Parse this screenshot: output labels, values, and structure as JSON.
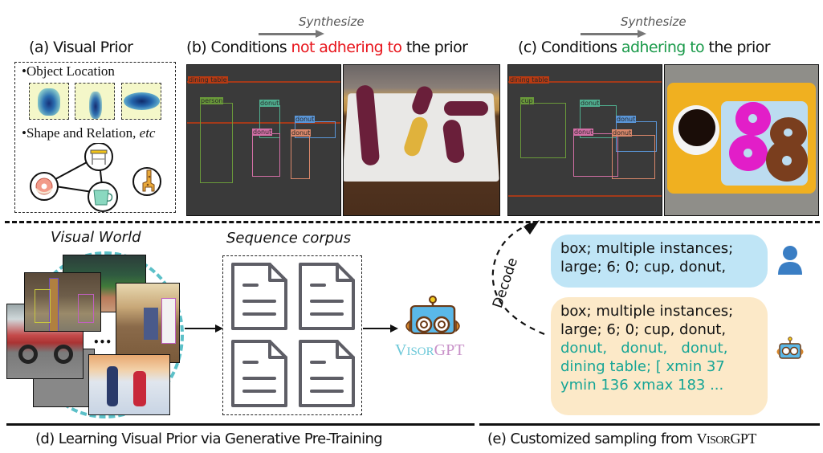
{
  "section_a": {
    "title": "(a) Visual Prior",
    "bullet_location": "•Object Location",
    "bullet_shape": "•Shape and Relation,",
    "bullet_shape_etc": "etc",
    "relation_icons": [
      "dining-table-icon",
      "donut-icon",
      "cup-icon",
      "giraffe-icon"
    ]
  },
  "section_b": {
    "synthesize": "Synthesize",
    "title_prefix": "(b) Conditions ",
    "title_highlight": "not adhering to",
    "title_suffix": " the prior",
    "highlight_color": "#e8141b",
    "boxes": [
      {
        "label": "dining table",
        "color": "#b83a12"
      },
      {
        "label": "person",
        "color": "#6a9a3a"
      },
      {
        "label": "donut",
        "color": "#4fae8f"
      },
      {
        "label": "donut",
        "color": "#5a96d8"
      },
      {
        "label": "donut",
        "color": "#d36fa6"
      },
      {
        "label": "donut",
        "color": "#d9876a"
      }
    ]
  },
  "section_c": {
    "synthesize": "Synthesize",
    "title_prefix": "(c) Conditions ",
    "title_highlight": "adhering to",
    "title_suffix": " the prior",
    "highlight_color": "#1a9a4a",
    "boxes": [
      {
        "label": "dining table",
        "color": "#b83a12"
      },
      {
        "label": "cup",
        "color": "#6a9a3a"
      },
      {
        "label": "donut",
        "color": "#4fae8f"
      },
      {
        "label": "donut",
        "color": "#5a96d8"
      },
      {
        "label": "donut",
        "color": "#d36fa6"
      },
      {
        "label": "donut",
        "color": "#d9876a"
      }
    ]
  },
  "section_d": {
    "visual_world": "Visual World",
    "ellipsis": "•••",
    "sequence_corpus": "Sequence corpus",
    "model_name_a": "V",
    "model_name_b": "ISOR",
    "model_name_c": "GPT",
    "caption": "(d) Learning Visual Prior via Generative Pre-Training"
  },
  "section_e": {
    "decode": "Decode",
    "user_prompt": [
      "box; multiple instances;",
      "large; 6; 0; cup, donut,"
    ],
    "model_output_black": [
      "box; multiple instances;",
      "large; 6; 0; cup, donut,"
    ],
    "model_output_teal": [
      "donut,   donut,   donut,",
      "dining table; [ xmin 37",
      "ymin 136 xmax 183 ..."
    ],
    "caption_prefix": "(e) Customized sampling from ",
    "caption_model_a": "V",
    "caption_model_b": "ISOR",
    "caption_model_c": "GPT"
  }
}
